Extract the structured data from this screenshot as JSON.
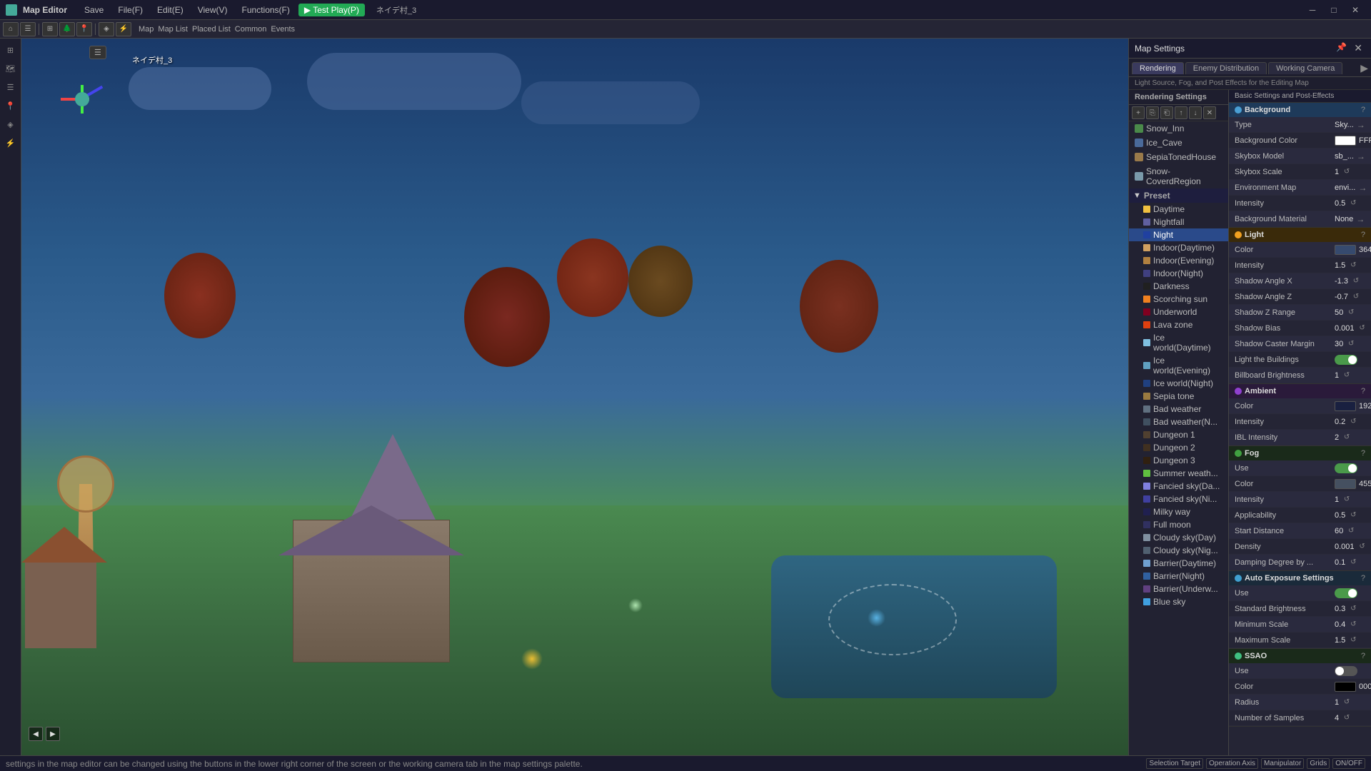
{
  "titlebar": {
    "app_icon": "map-editor-icon",
    "title": "Map Editor",
    "menus": [
      "File(F)",
      "Edit(E)",
      "View(V)",
      "Functions(F)",
      "Test Play(P)"
    ],
    "save_label": "Save",
    "coord_label": "ネイデ村_3",
    "win_btns": [
      "minimize",
      "maximize",
      "close"
    ]
  },
  "viewport": {
    "label": "3D Viewport"
  },
  "panel": {
    "title": "Map Settings",
    "tabs": [
      "Rendering",
      "Enemy Distribution",
      "Working Camera"
    ],
    "info_line": "Light Source, Fog, and Post Effects for the Editing Map"
  },
  "rendering_settings": {
    "header": "Rendering Settings",
    "items": [
      {
        "label": "Snow_Inn",
        "type": "scene"
      },
      {
        "label": "Ice_Cave",
        "type": "scene"
      },
      {
        "label": "SepiaTonedHouse",
        "type": "scene"
      },
      {
        "label": "Snow-CoverdRegion",
        "type": "scene"
      }
    ],
    "preset_header": "Preset",
    "presets": [
      {
        "label": "Daytime",
        "active": false
      },
      {
        "label": "Nightfall",
        "active": false
      },
      {
        "label": "Night",
        "active": true
      },
      {
        "label": "Indoor(Daytime)",
        "active": false
      },
      {
        "label": "Indoor(Evening)",
        "active": false
      },
      {
        "label": "Indoor(Night)",
        "active": false
      },
      {
        "label": "Darkness",
        "active": false
      },
      {
        "label": "Scorching sun",
        "active": false
      },
      {
        "label": "Underworld",
        "active": false
      },
      {
        "label": "Lava zone",
        "active": false
      },
      {
        "label": "Ice world(Daytime)",
        "active": false
      },
      {
        "label": "Ice world(Evening)",
        "active": false
      },
      {
        "label": "Ice world(Night)",
        "active": false
      },
      {
        "label": "Sepia tone",
        "active": false
      },
      {
        "label": "Bad weather",
        "active": false
      },
      {
        "label": "Bad weather(Night)",
        "active": false
      },
      {
        "label": "Dungeon 1",
        "active": false
      },
      {
        "label": "Dungeon 2",
        "active": false
      },
      {
        "label": "Dungeon 3",
        "active": false
      },
      {
        "label": "Summer weather",
        "active": false
      },
      {
        "label": "Fancied sky(Day)",
        "active": false
      },
      {
        "label": "Fancied sky(Night)",
        "active": false
      },
      {
        "label": "Milky way",
        "active": false
      },
      {
        "label": "Full moon",
        "active": false
      },
      {
        "label": "Cloudy sky(Day)",
        "active": false
      },
      {
        "label": "Cloudy sky(Night)",
        "active": false
      },
      {
        "label": "Barrier(Daytime)",
        "active": false
      },
      {
        "label": "Barrier(Night)",
        "active": false
      },
      {
        "label": "Barrier(Underworld)",
        "active": false
      },
      {
        "label": "Blue sky",
        "active": false
      }
    ]
  },
  "basic_settings": {
    "header": "Basic Settings and Post-Effects",
    "background": {
      "section_label": "Background",
      "properties": [
        {
          "label": "Type",
          "value": "Sky...",
          "has_arrow": true
        },
        {
          "label": "Background Color",
          "value": "FFF...",
          "is_color": true,
          "color": "#ffffff"
        },
        {
          "label": "Skybox Model",
          "value": "sb_...",
          "has_arrow": true
        },
        {
          "label": "Skybox Scale",
          "value": "1"
        },
        {
          "label": "Environment Map",
          "value": "envi...",
          "has_arrow": true
        },
        {
          "label": "Intensity",
          "value": "0.5"
        },
        {
          "label": "Background Material",
          "value": "None",
          "has_arrow": true
        }
      ]
    },
    "light": {
      "section_label": "Light",
      "properties": [
        {
          "label": "Color",
          "value": "364...",
          "is_color": true,
          "color": "#364a6e",
          "has_arrow": true
        },
        {
          "label": "Intensity",
          "value": "1.5"
        },
        {
          "label": "Shadow Angle X",
          "value": "-1.3"
        },
        {
          "label": "Shadow Angle Z",
          "value": "-0.7"
        },
        {
          "label": "Shadow Z Range",
          "value": "50"
        },
        {
          "label": "Shadow Bias",
          "value": "0.001"
        },
        {
          "label": "Shadow Caster Margin",
          "value": "30"
        },
        {
          "label": "Light the Buildings",
          "value": "toggle_on"
        },
        {
          "label": "Billboard Brightness",
          "value": "1"
        }
      ]
    },
    "ambient": {
      "section_label": "Ambient",
      "properties": [
        {
          "label": "Color",
          "value": "192...",
          "is_color": true,
          "color": "#192040",
          "has_arrow": true
        },
        {
          "label": "Intensity",
          "value": "0.2"
        },
        {
          "label": "IBL Intensity",
          "value": "2"
        }
      ]
    },
    "fog": {
      "section_label": "Fog",
      "properties": [
        {
          "label": "Use",
          "value": "toggle_on"
        },
        {
          "label": "Color",
          "value": "455...",
          "is_color": true,
          "color": "#455060",
          "has_arrow": true
        },
        {
          "label": "Intensity",
          "value": "1"
        },
        {
          "label": "Applicability",
          "value": "0.5"
        },
        {
          "label": "Start Distance",
          "value": "60"
        },
        {
          "label": "Density",
          "value": "0.001"
        },
        {
          "label": "Damping Degree by ...",
          "value": "0.1"
        }
      ]
    },
    "auto_exposure": {
      "section_label": "Auto Exposure Settings",
      "properties": [
        {
          "label": "Use",
          "value": "toggle_on"
        },
        {
          "label": "Standard Brightness",
          "value": "0.3"
        },
        {
          "label": "Minimum Scale",
          "value": "0.4"
        },
        {
          "label": "Maximum Scale",
          "value": "1.5"
        }
      ]
    },
    "ssao": {
      "section_label": "SSAO",
      "properties": [
        {
          "label": "Use",
          "value": "toggle_off"
        },
        {
          "label": "Color",
          "value": "000...",
          "is_color": true,
          "color": "#000000",
          "has_arrow": true
        },
        {
          "label": "Radius",
          "value": "1"
        },
        {
          "label": "Number of Samples",
          "value": "4"
        }
      ]
    }
  },
  "statusbar": {
    "text": "settings in the map editor can be changed using the buttons in the lower right corner of the screen or the working camera tab in the map settings palette.",
    "selection_target": "Selection Target",
    "operation_axis": "Operation Axis",
    "manipulator": "Manipulator",
    "grids": "Grids",
    "on_off": "ON/OFF"
  }
}
